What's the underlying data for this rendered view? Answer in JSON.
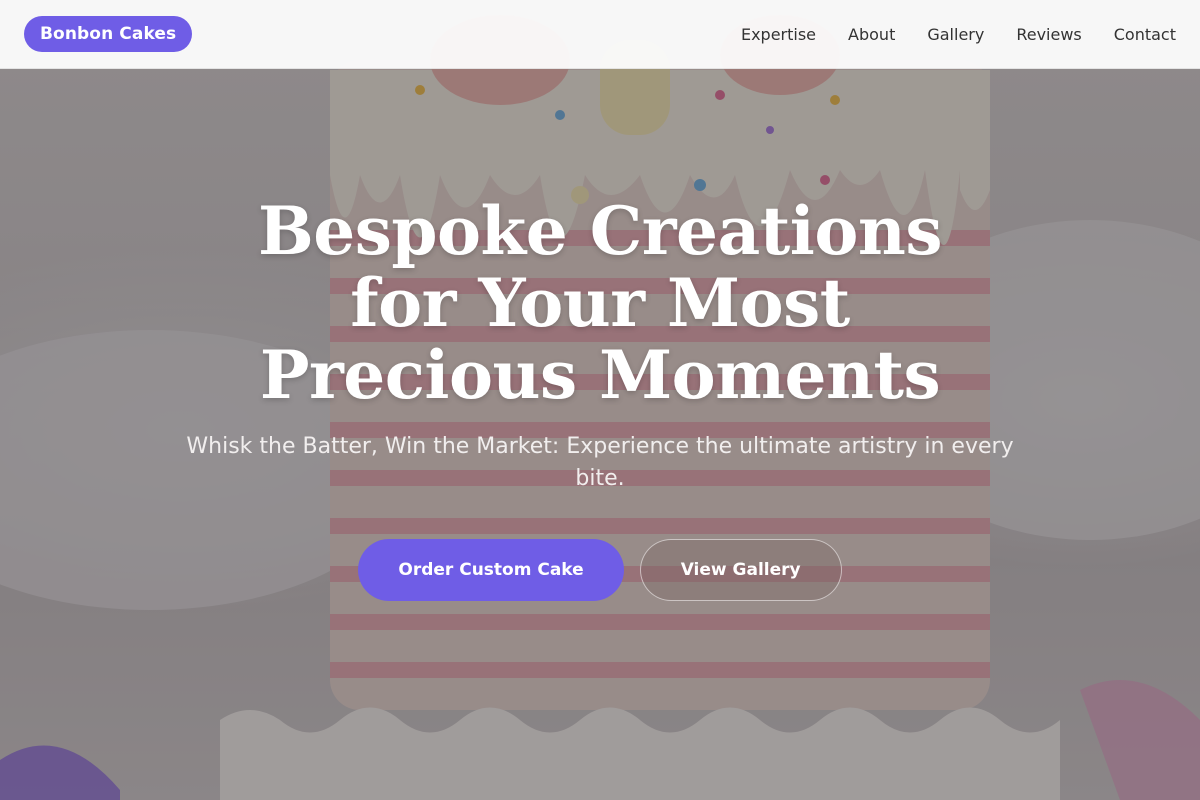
{
  "nav": {
    "brand": "Bonbon Cakes",
    "links": [
      "Expertise",
      "About",
      "Gallery",
      "Reviews",
      "Contact"
    ]
  },
  "hero": {
    "title": "Bespoke Creations for Your Most Precious Moments",
    "subtitle": "Whisk the Batter, Win the Market: Experience the ultimate artistry in every bite.",
    "primary_cta": "Order Custom Cake",
    "secondary_cta": "View Gallery",
    "background_image": "cake-photo"
  },
  "colors": {
    "accent": "#6f5de6",
    "nav_background": "#ffffff",
    "hero_text": "#ffffff"
  }
}
